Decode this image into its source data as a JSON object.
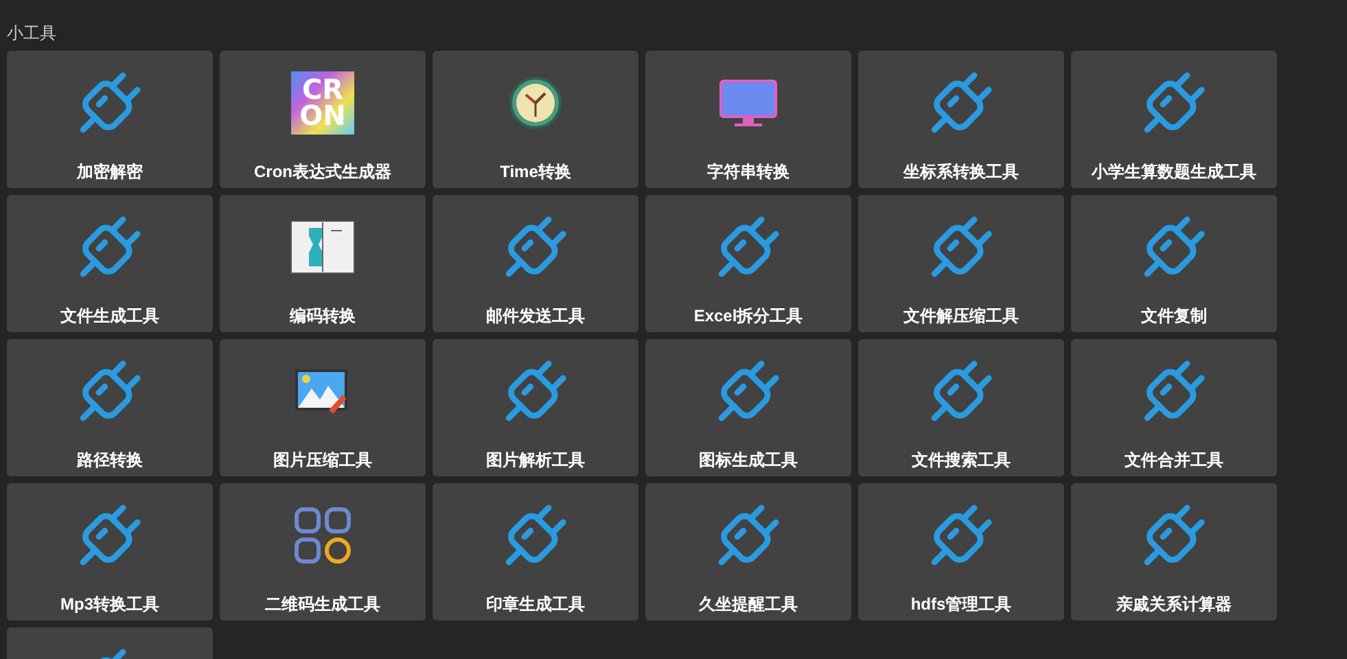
{
  "section": {
    "title": "小工具"
  },
  "tools": [
    {
      "kind": "plug",
      "label": "加密解密"
    },
    {
      "kind": "cron",
      "label": "Cron表达式生成器",
      "icon_text": [
        "CR",
        "ON"
      ]
    },
    {
      "kind": "clock",
      "label": "Time转换"
    },
    {
      "kind": "monitor",
      "label": "字符串转换"
    },
    {
      "kind": "plug",
      "label": "坐标系转换工具"
    },
    {
      "kind": "plug",
      "label": "小学生算数题生成工具"
    },
    {
      "kind": "plug",
      "label": "文件生成工具"
    },
    {
      "kind": "book",
      "label": "编码转换"
    },
    {
      "kind": "plug",
      "label": "邮件发送工具"
    },
    {
      "kind": "plug",
      "label": "Excel拆分工具"
    },
    {
      "kind": "plug",
      "label": "文件解压缩工具"
    },
    {
      "kind": "plug",
      "label": "文件复制"
    },
    {
      "kind": "plug",
      "label": "路径转换"
    },
    {
      "kind": "image",
      "label": "图片压缩工具"
    },
    {
      "kind": "plug",
      "label": "图片解析工具"
    },
    {
      "kind": "plug",
      "label": "图标生成工具"
    },
    {
      "kind": "plug",
      "label": "文件搜索工具"
    },
    {
      "kind": "plug",
      "label": "文件合并工具"
    },
    {
      "kind": "plug",
      "label": "Mp3转换工具"
    },
    {
      "kind": "grid",
      "label": "二维码生成工具"
    },
    {
      "kind": "plug",
      "label": "印章生成工具"
    },
    {
      "kind": "plug",
      "label": "久坐提醒工具"
    },
    {
      "kind": "plug",
      "label": "hdfs管理工具"
    },
    {
      "kind": "plug",
      "label": "亲戚关系计算器"
    },
    {
      "kind": "plug"
    }
  ]
}
